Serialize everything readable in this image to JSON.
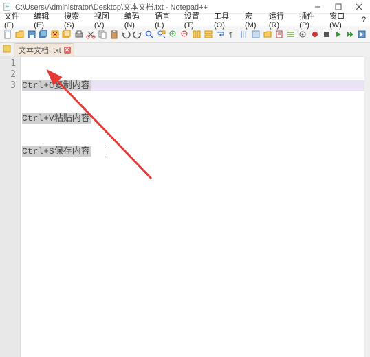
{
  "window": {
    "title": "C:\\Users\\Administrator\\Desktop\\文本文档.txt - Notepad++"
  },
  "menus": {
    "items": [
      "文件(F)",
      "编辑(E)",
      "搜索(S)",
      "视图(V)",
      "编码(N)",
      "语言(L)",
      "设置(T)",
      "工具(O)",
      "宏(M)",
      "运行(R)",
      "插件(P)",
      "窗口(W)"
    ],
    "help": "?"
  },
  "toolbar": {
    "icons": [
      "new-file-icon",
      "open-file-icon",
      "save-icon",
      "save-all-icon",
      "close-icon",
      "close-all-icon",
      "print-icon",
      "cut-icon",
      "copy-icon",
      "paste-icon",
      "undo-icon",
      "redo-icon",
      "find-icon",
      "replace-icon",
      "zoom-in-icon",
      "zoom-out-icon",
      "sync-v-icon",
      "sync-h-icon",
      "wrap-icon",
      "all-chars-icon",
      "indent-guide-icon",
      "lang-panel-icon",
      "folder-panel-icon",
      "doc-map-icon",
      "func-list-icon",
      "monitor-icon",
      "record-macro-icon",
      "stop-macro-icon",
      "play-macro-icon",
      "play-multi-icon",
      "save-macro-icon"
    ]
  },
  "tab": {
    "label": "文本文档. txt"
  },
  "editor": {
    "line_numbers": [
      "1",
      "2",
      "3"
    ],
    "lines": [
      "Ctrl+C复制内容",
      "Ctrl+V粘贴内容",
      "Ctrl+S保存内容"
    ],
    "cursor_hint": "|"
  },
  "colors": {
    "line_highlight": "#e9e3f5",
    "selection": "#cfcfcf",
    "arrow": "#e53935"
  }
}
